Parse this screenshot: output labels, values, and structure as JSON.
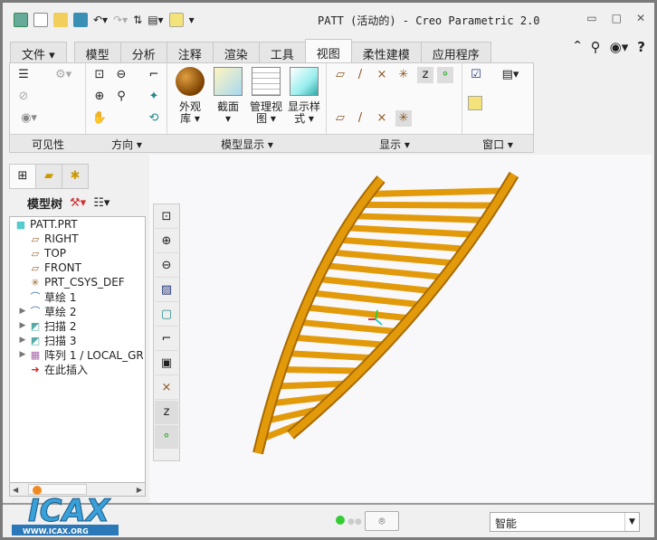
{
  "window": {
    "title": "PATT (活动的) - Creo Parametric 2.0",
    "minimize": "▭",
    "maximize": "□",
    "close": "✕"
  },
  "tabs": [
    {
      "label": "文件 ▾"
    },
    {
      "label": "模型"
    },
    {
      "label": "分析"
    },
    {
      "label": "注释"
    },
    {
      "label": "渲染"
    },
    {
      "label": "工具"
    },
    {
      "label": "视图",
      "active": true
    },
    {
      "label": "柔性建模"
    },
    {
      "label": "应用程序"
    }
  ],
  "ribbon": {
    "groups": [
      {
        "label": "可见性"
      },
      {
        "label": "方向 ▾"
      },
      {
        "label": "模型显示 ▾"
      },
      {
        "label": "显示 ▾"
      },
      {
        "label": "窗口 ▾"
      }
    ],
    "big_buttons": [
      {
        "label": "外观\n库 ▾",
        "icon": "appearance-sphere-icon"
      },
      {
        "label": "截面\n▾",
        "icon": "section-icon"
      },
      {
        "label": "管理视\n图 ▾",
        "icon": "manage-views-icon"
      },
      {
        "label": "显示样\n式 ▾",
        "icon": "display-style-icon"
      }
    ]
  },
  "model_tree": {
    "label": "模型树",
    "items": [
      {
        "label": "PATT.PRT",
        "icon": "part-icon",
        "expandable": false,
        "indent": 0
      },
      {
        "label": "RIGHT",
        "icon": "datum-plane-icon",
        "expandable": false,
        "indent": 1
      },
      {
        "label": "TOP",
        "icon": "datum-plane-icon",
        "expandable": false,
        "indent": 1
      },
      {
        "label": "FRONT",
        "icon": "datum-plane-icon",
        "expandable": false,
        "indent": 1
      },
      {
        "label": "PRT_CSYS_DEF",
        "icon": "csys-icon",
        "expandable": false,
        "indent": 1
      },
      {
        "label": "草绘 1",
        "icon": "sketch-icon",
        "expandable": false,
        "indent": 1
      },
      {
        "label": "草绘 2",
        "icon": "sketch-icon",
        "expandable": true,
        "indent": 1
      },
      {
        "label": "扫描 2",
        "icon": "sweep-icon",
        "expandable": true,
        "indent": 1
      },
      {
        "label": "扫描 3",
        "icon": "sweep-icon",
        "expandable": true,
        "indent": 1
      },
      {
        "label": "阵列 1 / LOCAL_GR",
        "icon": "pattern-icon",
        "expandable": true,
        "indent": 1
      },
      {
        "label": "在此插入",
        "icon": "insert-here-icon",
        "expandable": false,
        "indent": 1
      }
    ]
  },
  "status": {
    "filter": "智能",
    "logo_text": "WWW.ICAX.ORG"
  },
  "colors": {
    "model": "#e39a0a",
    "accent": "#3aa0d8"
  }
}
